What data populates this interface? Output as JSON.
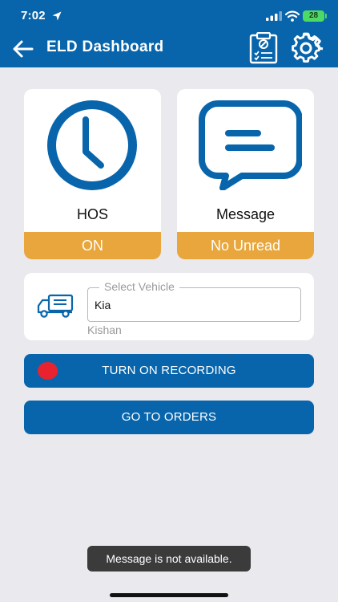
{
  "status_bar": {
    "time": "7:02",
    "battery": "28"
  },
  "app_bar": {
    "title": "ELD Dashboard"
  },
  "cards": {
    "hos": {
      "label": "HOS",
      "status": "ON"
    },
    "message": {
      "label": "Message",
      "status": "No Unread"
    }
  },
  "vehicle": {
    "field_label": "Select Vehicle",
    "value": "Kia",
    "driver": "Kishan"
  },
  "buttons": {
    "recording_label": "TURN ON RECORDING",
    "orders_label": "GO TO ORDERS"
  },
  "toast": {
    "text": "Message is not available."
  },
  "colors": {
    "primary": "#0865ab",
    "accent": "#e8a63c",
    "record": "#e8232f",
    "background": "#e9e9ee"
  },
  "icons": {
    "status_location": "location-arrow-icon",
    "signal": "cellular-signal-icon",
    "wifi": "wifi-icon",
    "back": "back-arrow-icon",
    "logs": "clipboard-icon",
    "settings": "gear-icon",
    "hos": "clock-icon",
    "message": "chat-bubble-icon",
    "vehicle": "truck-icon"
  }
}
